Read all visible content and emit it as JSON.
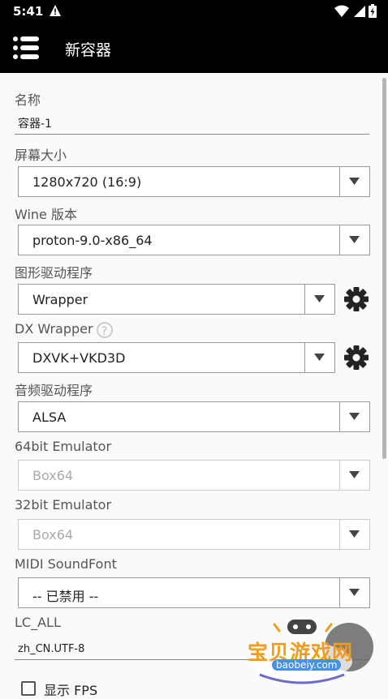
{
  "status_bar": {
    "time": "5:41"
  },
  "app_bar": {
    "title": "新容器"
  },
  "form": {
    "name_label": "名称",
    "name_value": "容器-1",
    "screen_label": "屏幕大小",
    "screen_value": "1280x720 (16:9)",
    "wine_label": "Wine 版本",
    "wine_value": "proton-9.0-x86_64",
    "gfx_label": "图形驱动程序",
    "gfx_value": "Wrapper",
    "dx_label": "DX Wrapper",
    "dx_help": "?",
    "dx_value": "DXVK+VKD3D",
    "audio_label": "音频驱动程序",
    "audio_value": "ALSA",
    "emu64_label": "64bit Emulator",
    "emu64_value": "Box64",
    "emu32_label": "32bit Emulator",
    "emu32_value": "Box64",
    "midi_label": "MIDI SoundFont",
    "midi_value": "-- 已禁用 --",
    "lcall_label": "LC_ALL",
    "lcall_value": "zh_CN.UTF-8",
    "fps_label": "显示 FPS"
  },
  "watermark": {
    "text": "宝贝游戏网",
    "url": "baobeiy.com"
  },
  "colors": {
    "bar": "#000000",
    "background": "#fafafa",
    "watermark_orange": "#f29b1d"
  }
}
